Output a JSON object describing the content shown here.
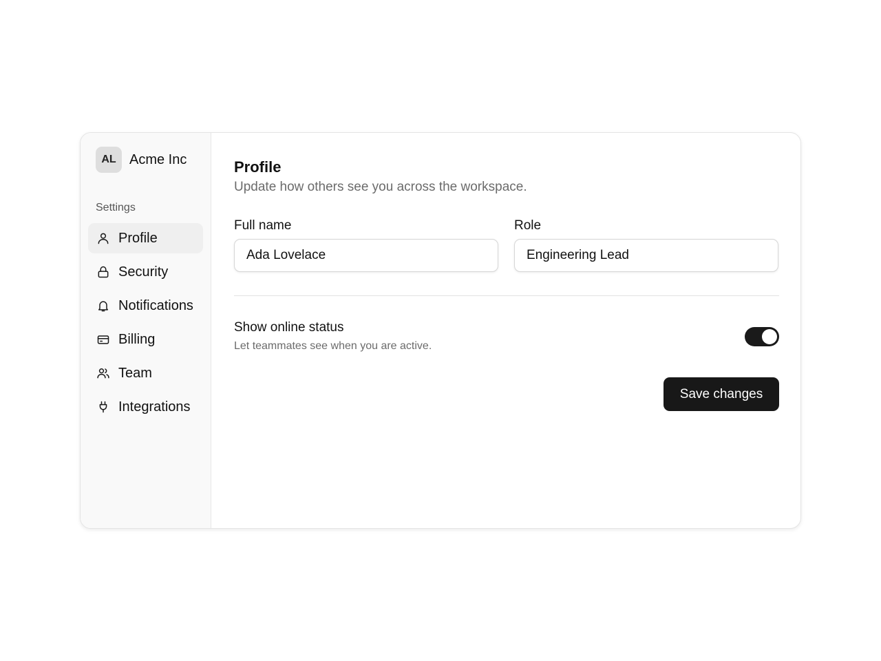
{
  "brand": {
    "avatar_initials": "AL",
    "name": "Acme Inc"
  },
  "sidebar": {
    "section_label": "Settings",
    "items": [
      {
        "label": "Profile",
        "icon": "user-icon",
        "active": true
      },
      {
        "label": "Security",
        "icon": "lock-icon",
        "active": false
      },
      {
        "label": "Notifications",
        "icon": "bell-icon",
        "active": false
      },
      {
        "label": "Billing",
        "icon": "credit-card-icon",
        "active": false
      },
      {
        "label": "Team",
        "icon": "users-icon",
        "active": false
      },
      {
        "label": "Integrations",
        "icon": "plug-icon",
        "active": false
      }
    ]
  },
  "main": {
    "title": "Profile",
    "subtitle": "Update how others see you across the workspace.",
    "full_name": {
      "label": "Full name",
      "value": "Ada Lovelace"
    },
    "role": {
      "label": "Role",
      "value": "Engineering Lead"
    },
    "online_status": {
      "title": "Show online status",
      "description": "Let teammates see when you are active.",
      "enabled": true
    },
    "save_label": "Save changes"
  },
  "colors": {
    "primary": "#181818",
    "sidebar_bg": "#f9f9f9",
    "active_item_bg": "#efefef",
    "muted_text": "#6b6b6b"
  }
}
